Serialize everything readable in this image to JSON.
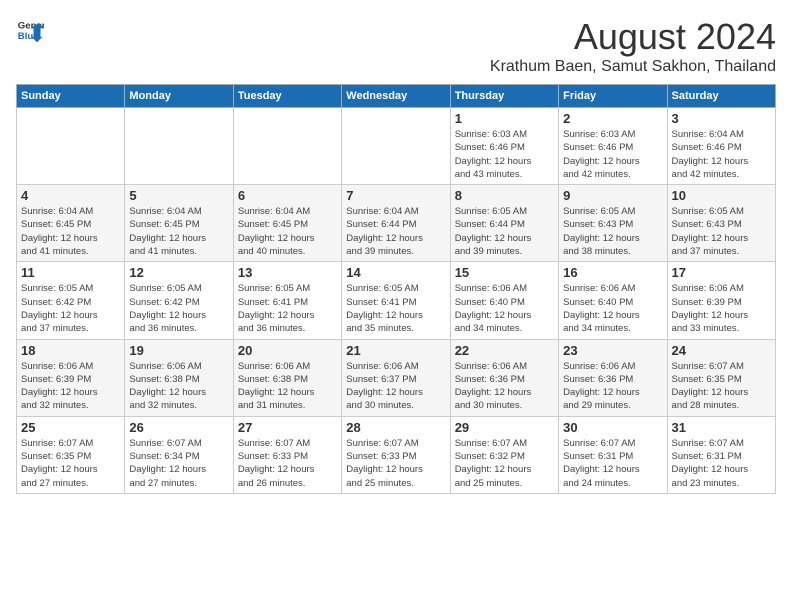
{
  "header": {
    "logo_line1": "General",
    "logo_line2": "Blue",
    "title": "August 2024",
    "subtitle": "Krathum Baen, Samut Sakhon, Thailand"
  },
  "weekdays": [
    "Sunday",
    "Monday",
    "Tuesday",
    "Wednesday",
    "Thursday",
    "Friday",
    "Saturday"
  ],
  "weeks": [
    [
      {
        "day": "",
        "detail": ""
      },
      {
        "day": "",
        "detail": ""
      },
      {
        "day": "",
        "detail": ""
      },
      {
        "day": "",
        "detail": ""
      },
      {
        "day": "1",
        "detail": "Sunrise: 6:03 AM\nSunset: 6:46 PM\nDaylight: 12 hours\nand 43 minutes."
      },
      {
        "day": "2",
        "detail": "Sunrise: 6:03 AM\nSunset: 6:46 PM\nDaylight: 12 hours\nand 42 minutes."
      },
      {
        "day": "3",
        "detail": "Sunrise: 6:04 AM\nSunset: 6:46 PM\nDaylight: 12 hours\nand 42 minutes."
      }
    ],
    [
      {
        "day": "4",
        "detail": "Sunrise: 6:04 AM\nSunset: 6:45 PM\nDaylight: 12 hours\nand 41 minutes."
      },
      {
        "day": "5",
        "detail": "Sunrise: 6:04 AM\nSunset: 6:45 PM\nDaylight: 12 hours\nand 41 minutes."
      },
      {
        "day": "6",
        "detail": "Sunrise: 6:04 AM\nSunset: 6:45 PM\nDaylight: 12 hours\nand 40 minutes."
      },
      {
        "day": "7",
        "detail": "Sunrise: 6:04 AM\nSunset: 6:44 PM\nDaylight: 12 hours\nand 39 minutes."
      },
      {
        "day": "8",
        "detail": "Sunrise: 6:05 AM\nSunset: 6:44 PM\nDaylight: 12 hours\nand 39 minutes."
      },
      {
        "day": "9",
        "detail": "Sunrise: 6:05 AM\nSunset: 6:43 PM\nDaylight: 12 hours\nand 38 minutes."
      },
      {
        "day": "10",
        "detail": "Sunrise: 6:05 AM\nSunset: 6:43 PM\nDaylight: 12 hours\nand 37 minutes."
      }
    ],
    [
      {
        "day": "11",
        "detail": "Sunrise: 6:05 AM\nSunset: 6:42 PM\nDaylight: 12 hours\nand 37 minutes."
      },
      {
        "day": "12",
        "detail": "Sunrise: 6:05 AM\nSunset: 6:42 PM\nDaylight: 12 hours\nand 36 minutes."
      },
      {
        "day": "13",
        "detail": "Sunrise: 6:05 AM\nSunset: 6:41 PM\nDaylight: 12 hours\nand 36 minutes."
      },
      {
        "day": "14",
        "detail": "Sunrise: 6:05 AM\nSunset: 6:41 PM\nDaylight: 12 hours\nand 35 minutes."
      },
      {
        "day": "15",
        "detail": "Sunrise: 6:06 AM\nSunset: 6:40 PM\nDaylight: 12 hours\nand 34 minutes."
      },
      {
        "day": "16",
        "detail": "Sunrise: 6:06 AM\nSunset: 6:40 PM\nDaylight: 12 hours\nand 34 minutes."
      },
      {
        "day": "17",
        "detail": "Sunrise: 6:06 AM\nSunset: 6:39 PM\nDaylight: 12 hours\nand 33 minutes."
      }
    ],
    [
      {
        "day": "18",
        "detail": "Sunrise: 6:06 AM\nSunset: 6:39 PM\nDaylight: 12 hours\nand 32 minutes."
      },
      {
        "day": "19",
        "detail": "Sunrise: 6:06 AM\nSunset: 6:38 PM\nDaylight: 12 hours\nand 32 minutes."
      },
      {
        "day": "20",
        "detail": "Sunrise: 6:06 AM\nSunset: 6:38 PM\nDaylight: 12 hours\nand 31 minutes."
      },
      {
        "day": "21",
        "detail": "Sunrise: 6:06 AM\nSunset: 6:37 PM\nDaylight: 12 hours\nand 30 minutes."
      },
      {
        "day": "22",
        "detail": "Sunrise: 6:06 AM\nSunset: 6:36 PM\nDaylight: 12 hours\nand 30 minutes."
      },
      {
        "day": "23",
        "detail": "Sunrise: 6:06 AM\nSunset: 6:36 PM\nDaylight: 12 hours\nand 29 minutes."
      },
      {
        "day": "24",
        "detail": "Sunrise: 6:07 AM\nSunset: 6:35 PM\nDaylight: 12 hours\nand 28 minutes."
      }
    ],
    [
      {
        "day": "25",
        "detail": "Sunrise: 6:07 AM\nSunset: 6:35 PM\nDaylight: 12 hours\nand 27 minutes."
      },
      {
        "day": "26",
        "detail": "Sunrise: 6:07 AM\nSunset: 6:34 PM\nDaylight: 12 hours\nand 27 minutes."
      },
      {
        "day": "27",
        "detail": "Sunrise: 6:07 AM\nSunset: 6:33 PM\nDaylight: 12 hours\nand 26 minutes."
      },
      {
        "day": "28",
        "detail": "Sunrise: 6:07 AM\nSunset: 6:33 PM\nDaylight: 12 hours\nand 25 minutes."
      },
      {
        "day": "29",
        "detail": "Sunrise: 6:07 AM\nSunset: 6:32 PM\nDaylight: 12 hours\nand 25 minutes."
      },
      {
        "day": "30",
        "detail": "Sunrise: 6:07 AM\nSunset: 6:31 PM\nDaylight: 12 hours\nand 24 minutes."
      },
      {
        "day": "31",
        "detail": "Sunrise: 6:07 AM\nSunset: 6:31 PM\nDaylight: 12 hours\nand 23 minutes."
      }
    ]
  ]
}
